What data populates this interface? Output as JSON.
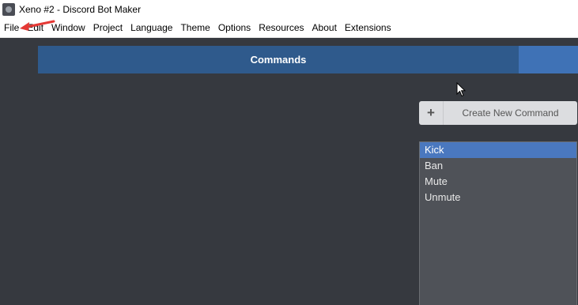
{
  "window": {
    "title": "Xeno #2 - Discord Bot Maker",
    "icon": "app-icon"
  },
  "menu": {
    "items": [
      "File",
      "Edit",
      "Window",
      "Project",
      "Language",
      "Theme",
      "Options",
      "Resources",
      "About",
      "Extensions"
    ]
  },
  "tabs": {
    "commands_label": "Commands"
  },
  "create_button": {
    "icon": "plus-icon",
    "plus": "+",
    "label": "Create New Command"
  },
  "commands": {
    "items": [
      "Kick",
      "Ban",
      "Mute",
      "Unmute"
    ],
    "selected": "Kick"
  },
  "colors": {
    "background": "#36393f",
    "tab_active": "#2f5a8c",
    "tab_secondary": "#3f72b6",
    "list_selected": "#4a78bf",
    "annotation_arrow": "#e53935"
  }
}
